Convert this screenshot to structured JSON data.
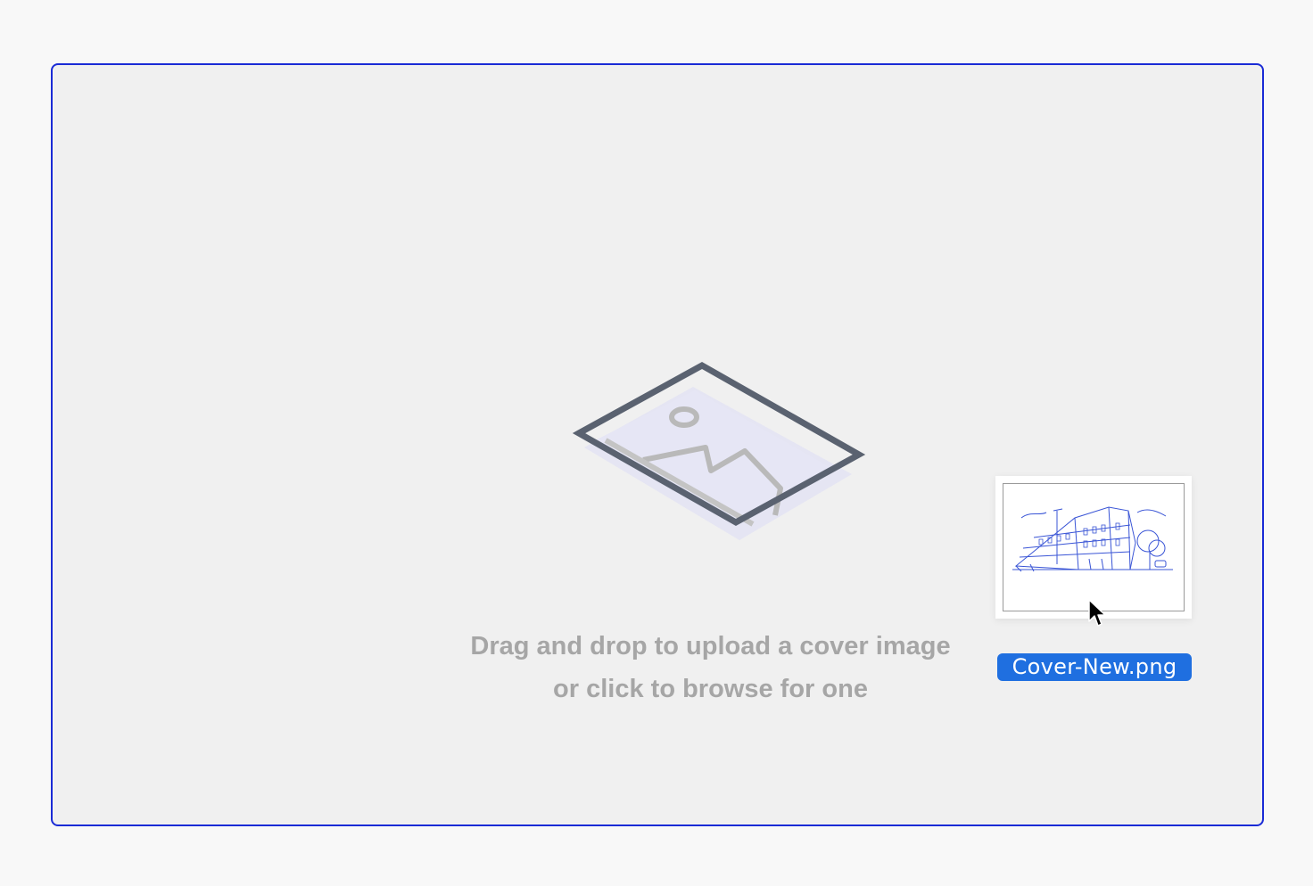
{
  "dropzone": {
    "line1": "Drag and drop to upload a cover image",
    "line2": "or click to browse for one",
    "border_color": "#1a2bd6",
    "icon": "image-placeholder-icon"
  },
  "dragged_file": {
    "name": "Cover-New.png",
    "label_color": "#1f6fe0",
    "thumbnail": "building-sketch-thumbnail"
  },
  "pointer": {
    "icon": "arrow-cursor-icon"
  }
}
